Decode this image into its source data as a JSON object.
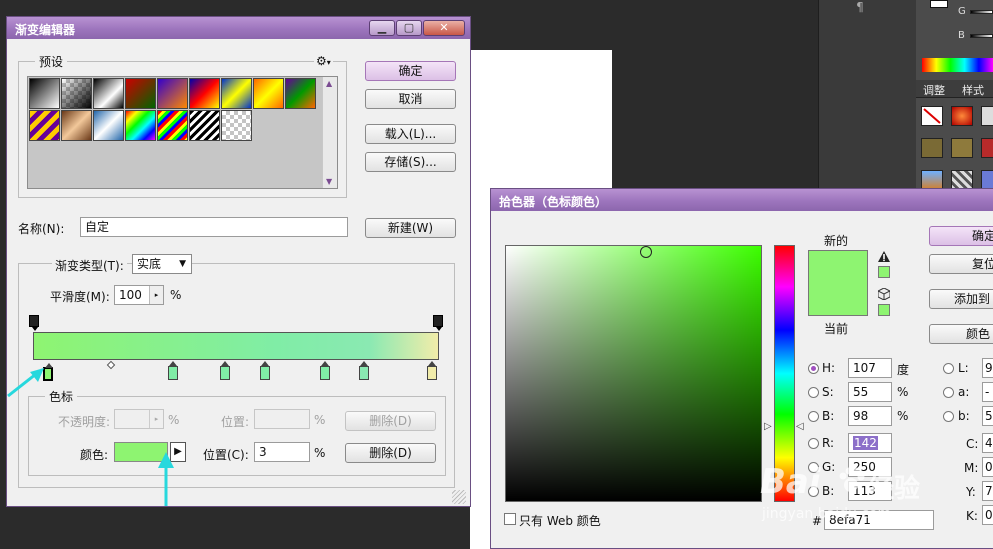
{
  "gradient_editor": {
    "title": "渐变编辑器",
    "presets_label": "预设",
    "gear_symbol": "⚙",
    "ok_button": "确定",
    "cancel_button": "取消",
    "load_button": "载入(L)...",
    "save_button": "存储(S)...",
    "name_label": "名称(N):",
    "name_value": "自定",
    "new_button": "新建(W)",
    "gradient_type_label": "渐变类型(T):",
    "gradient_type_value": "实底",
    "smoothness_label": "平滑度(M):",
    "smoothness_value": "100",
    "smoothness_unit": "%",
    "color_stops_group": "色标",
    "opacity_label": "不透明度:",
    "opacity_unit": "%",
    "location_label_1": "位置:",
    "location_unit_1": "%",
    "delete_button_1": "删除(D)",
    "color_label": "颜色:",
    "color_swatch": "#8ef471",
    "location_label_2": "位置(C):",
    "location_value_2": "3",
    "location_unit_2": "%",
    "delete_button_2": "删除(D)",
    "preset_swatches": [
      "black-white",
      "transparent-black",
      "black-white-alt",
      "red-green",
      "violet-orange",
      "blue-red-yellow",
      "blue-yellow-blue",
      "orange-yellow",
      "violet-green-orange",
      "yellow-violet-stripes",
      "copper",
      "chrome",
      "spectrum",
      "rainbow-stripes",
      "black-white-stripes",
      "transparent"
    ],
    "colors": {
      "accent": "#9d75bd",
      "gradient_start": "#8ef471",
      "gradient_mid": "#80eda6",
      "gradient_end": "#f1ecaa"
    }
  },
  "color_picker": {
    "title": "拾色器（色标颜色）",
    "new_label": "新的",
    "current_label": "当前",
    "new_color": "#8ef471",
    "current_color": "#8ef471",
    "ok_button": "确定",
    "reset_button": "复位",
    "add_swatch_button": "添加到",
    "color_library_button": "颜色",
    "h_label": "H:",
    "h_value": "107",
    "h_unit": "度",
    "s_label": "S:",
    "s_value": "55",
    "s_unit": "%",
    "b_label": "B:",
    "b_value": "98",
    "b_unit": "%",
    "r_label": "R:",
    "r_value": "142",
    "g_label": "G:",
    "g_value": "250",
    "bb_label": "B:",
    "bb_value": "113",
    "hex_label": "#",
    "hex_value": "8efa71",
    "web_only_label": "只有 Web 颜色",
    "l_label": "L:",
    "l_value": "9",
    "a_label": "a:",
    "a_value": "-",
    "lb_label": "b:",
    "lb_value": "5",
    "c_label": "C:",
    "c_value": "4",
    "m_label": "M:",
    "m_value": "0",
    "y_label": "Y:",
    "y_value": "7",
    "k_label": "K:",
    "k_value": "0"
  },
  "ps_panel": {
    "g_label": "G",
    "b_label": "B",
    "tab_adjust": "调整",
    "tab_styles": "样式",
    "pilcrow": "¶"
  },
  "watermark": {
    "brand": "Bai",
    "brand_suffix": "经验",
    "url": "jingyan.baidu.com"
  }
}
